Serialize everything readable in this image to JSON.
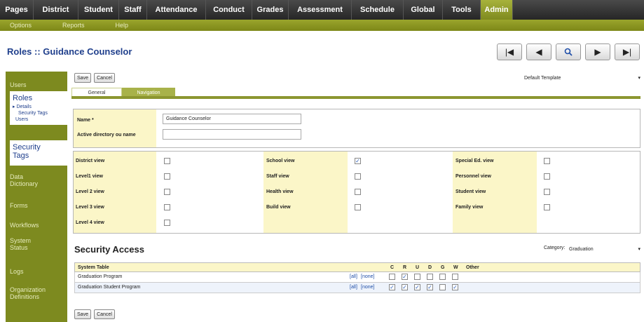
{
  "topnav": {
    "tabs": [
      "Pages",
      "District",
      "Student",
      "Staff",
      "Attendance",
      "Conduct",
      "Grades",
      "Assessment",
      "Schedule",
      "Global",
      "Tools",
      "Admin"
    ],
    "active": "Admin"
  },
  "subnav": {
    "items": [
      "Options",
      "Reports",
      "Help"
    ]
  },
  "page": {
    "title": "Roles :: Guidance Counselor"
  },
  "navbuttons": {
    "first": "⏮",
    "prev": "◀",
    "search": "🔍",
    "next": "▶",
    "last": "⏭"
  },
  "sidebar": {
    "users": "Users",
    "roles": "Roles",
    "roles_sub": [
      "▸ Details",
      "Security Tags",
      "Users"
    ],
    "security_tags": [
      "Security",
      "Tags"
    ],
    "data_dictionary": [
      "Data",
      "Dictionary"
    ],
    "forms": "Forms",
    "workflows": "Workflows",
    "system_status": [
      "System",
      "Status"
    ],
    "logs": "Logs",
    "org_definitions": [
      "Organization",
      "Definitions"
    ]
  },
  "toolbar": {
    "save": "Save",
    "cancel": "Cancel",
    "template": "Default Template"
  },
  "tabs": {
    "general": "General",
    "navigation": "Navigation"
  },
  "form": {
    "name_label": "Name *",
    "name_value": "Guidance Counselor",
    "ad_label": "Active directory ou name",
    "ad_value": ""
  },
  "views": [
    {
      "label": "District view",
      "checked": false
    },
    {
      "label": "Level1 view",
      "checked": false
    },
    {
      "label": "Level 2 view",
      "checked": false
    },
    {
      "label": "Level 3 view",
      "checked": false
    },
    {
      "label": "Level 4 view",
      "checked": false
    },
    {
      "label": "School view",
      "checked": true
    },
    {
      "label": "Staff view",
      "checked": false
    },
    {
      "label": "Health view",
      "checked": false
    },
    {
      "label": "Build view",
      "checked": false
    },
    {
      "label": "Special Ed. view",
      "checked": false
    },
    {
      "label": "Personnel view",
      "checked": false
    },
    {
      "label": "Student view",
      "checked": false
    },
    {
      "label": "Family view",
      "checked": false
    }
  ],
  "security": {
    "title": "Security Access",
    "category_label": "Category:",
    "category_value": "Graduation",
    "headers": [
      "System Table",
      "C",
      "R",
      "U",
      "D",
      "G",
      "W",
      "Other"
    ],
    "rows": [
      {
        "name": "Graduation Program",
        "all": "[all]",
        "none": "[none]",
        "checks": [
          false,
          true,
          false,
          false,
          false,
          false
        ]
      },
      {
        "name": "Graduation Student Program",
        "all": "[all]",
        "none": "[none]",
        "checks": [
          true,
          true,
          true,
          true,
          false,
          true
        ]
      }
    ]
  }
}
